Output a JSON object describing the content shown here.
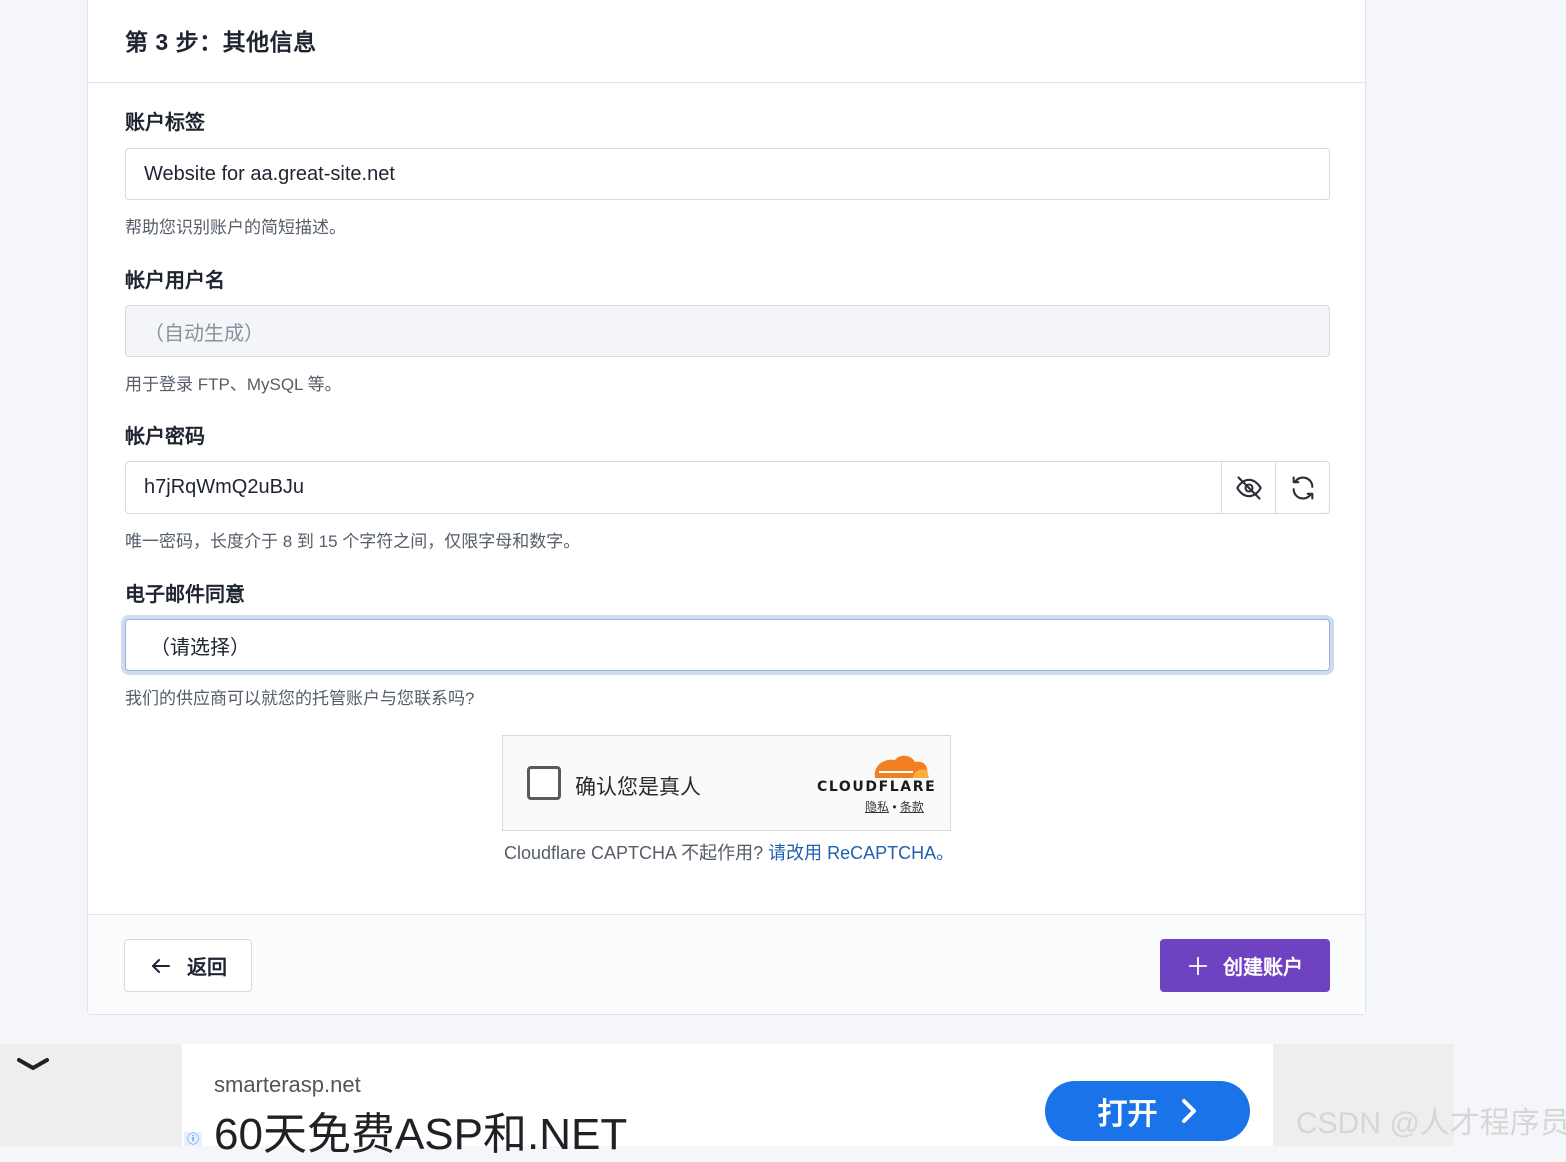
{
  "step": {
    "title": "第 3 步：其他信息"
  },
  "account_label": {
    "label": "账户标签",
    "value": "Website for aa.great-site.net",
    "help": "帮助您识别账户的简短描述。"
  },
  "account_username": {
    "label": "帐户用户名",
    "placeholder": "（自动生成）",
    "help": "用于登录 FTP、MySQL 等。"
  },
  "account_password": {
    "label": "帐户密码",
    "value": "h7jRqWmQ2uBJu",
    "help": "唯一密码，长度介于 8 到 15 个字符之间，仅限字母和数字。",
    "toggle_icon": "eye-slash-icon",
    "regenerate_icon": "refresh-icon"
  },
  "email_consent": {
    "label": "电子邮件同意",
    "selected": "（请选择）",
    "help": "我们的供应商可以就您的托管账户与您联系吗?"
  },
  "captcha": {
    "checkbox_label": "确认您是真人",
    "brand": "CLOUDFLARE",
    "privacy": "隐私",
    "separator": "•",
    "terms": "条款",
    "note": "Cloudflare CAPTCHA 不起作用?",
    "alt_link": "请改用 ReCAPTCHA。",
    "brand_color": "#f38020"
  },
  "footer": {
    "back_label": "返回",
    "create_label": "创建账户",
    "create_color": "#6f42c1"
  },
  "ad": {
    "domain": "smarterasp.net",
    "headline": "60天免费ASP和.NET",
    "open_label": "打开",
    "info": "ⓘ"
  },
  "watermark": "CSDN @人才程序员"
}
